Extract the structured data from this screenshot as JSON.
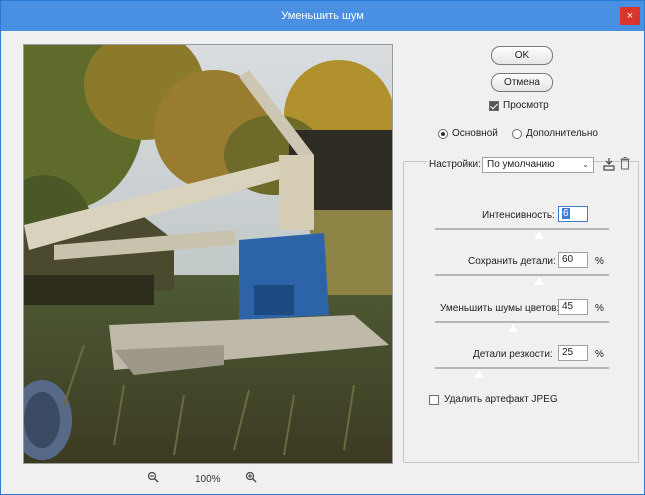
{
  "window": {
    "title": "Уменьшить шум",
    "close_glyph": "×"
  },
  "buttons": {
    "ok": "OK",
    "cancel": "Отмена"
  },
  "preview_check": {
    "label": "Просмотр",
    "checked": true
  },
  "modes": [
    {
      "label": "Основной",
      "selected": true
    },
    {
      "label": "Дополнительно",
      "selected": false
    }
  ],
  "settings": {
    "label": "Настройки:",
    "value": "По умолчанию"
  },
  "sliders": [
    {
      "label": "Интенсивность:",
      "value": "6",
      "unit": "",
      "fraction": 0.6
    },
    {
      "label": "Сохранить детали:",
      "value": "60",
      "unit": "%",
      "fraction": 0.6
    },
    {
      "label": "Уменьшить шумы цветов:",
      "value": "45",
      "unit": "%",
      "fraction": 0.45
    },
    {
      "label": "Детали резкости:",
      "value": "25",
      "unit": "%",
      "fraction": 0.25
    }
  ],
  "jpeg_check": {
    "label": "Удалить артефакт JPEG",
    "checked": false
  },
  "zoom": {
    "value": "100%",
    "zoom_out_icon": "zoom-out-icon",
    "zoom_in_icon": "zoom-in-icon"
  },
  "colors": {
    "title_bar": "#4a90e2",
    "close": "#d9362b",
    "focus": "#3e7bd6"
  }
}
